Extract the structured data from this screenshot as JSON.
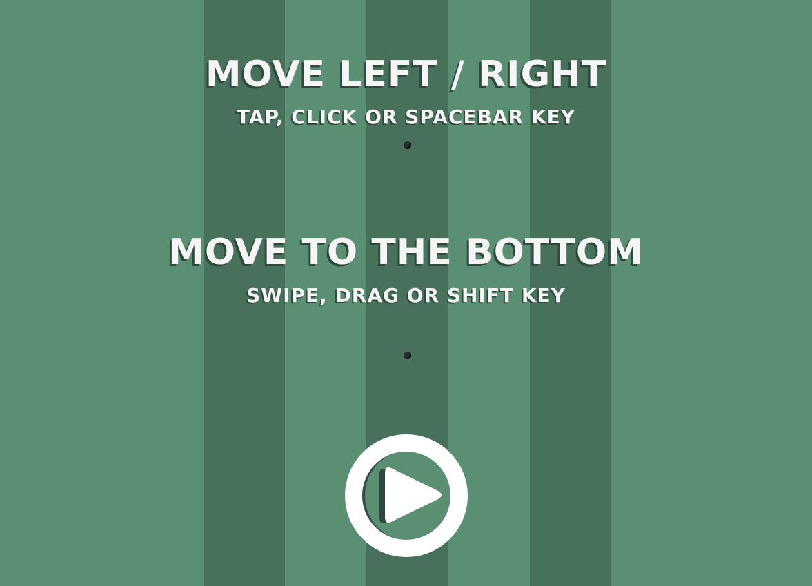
{
  "colors": {
    "stripe_dark": "#48715c",
    "stripe_light": "#5a8f74",
    "text": "#f5f5f5",
    "text_shadow": "#2f4a3c",
    "ball": "#2b2b2b",
    "button_fill": "#ffffff",
    "button_shadow": "#2f4a3c"
  },
  "instructions": [
    {
      "title": "MOVE LEFT / RIGHT",
      "subtitle": "TAP, CLICK OR SPACEBAR KEY"
    },
    {
      "title": "MOVE TO THE BOTTOM",
      "subtitle": "SWIPE, DRAG OR SHIFT KEY"
    }
  ],
  "play_button": {
    "icon": "play-icon"
  }
}
